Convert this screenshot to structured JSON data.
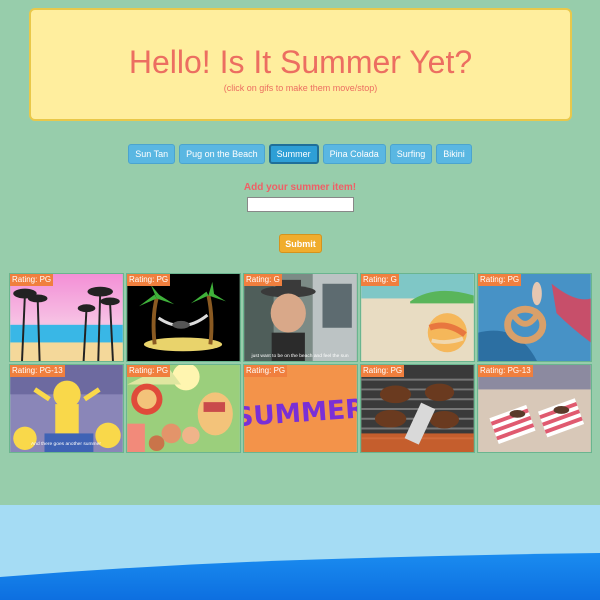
{
  "header": {
    "title": "Hello! Is It Summer Yet?",
    "subtitle": "(click on gifs to make them move/stop)"
  },
  "topics": [
    {
      "label": "Sun Tan",
      "active": false
    },
    {
      "label": "Pug on the Beach",
      "active": false
    },
    {
      "label": "Summer",
      "active": true
    },
    {
      "label": "Pina Colada",
      "active": false
    },
    {
      "label": "Surfing",
      "active": false
    },
    {
      "label": "Bikini",
      "active": false
    }
  ],
  "form": {
    "label": "Add your summer item!",
    "input_value": "",
    "submit_label": "Submit"
  },
  "gifs": [
    {
      "rating": "Rating: PG",
      "icon": "palm-beach-gif"
    },
    {
      "rating": "Rating: PG",
      "icon": "hammock-palm-gif"
    },
    {
      "rating": "Rating: G",
      "icon": "man-in-hat-gif",
      "caption": "just want to be on the beach and feel the sun"
    },
    {
      "rating": "Rating: G",
      "icon": "beach-ball-gif"
    },
    {
      "rating": "Rating: PG",
      "icon": "pretzel-float-gif"
    },
    {
      "rating": "Rating: PG-13",
      "icon": "simpsons-gif",
      "caption": "And there goes another summer"
    },
    {
      "rating": "Rating: PG",
      "icon": "cartoon-party-gif"
    },
    {
      "rating": "Rating: PG",
      "icon": "summer-text-gif",
      "text": "SUMMER"
    },
    {
      "rating": "Rating: PG",
      "icon": "grill-burgers-gif"
    },
    {
      "rating": "Rating: PG-13",
      "icon": "beach-towels-gif"
    }
  ],
  "colors": {
    "background": "#97cdab",
    "header_bg": "#ffee9e",
    "title": "#ec6e61",
    "button": "#5ab7e2",
    "submit": "#f0ad2d",
    "rating_badge": "#f07f3e"
  }
}
